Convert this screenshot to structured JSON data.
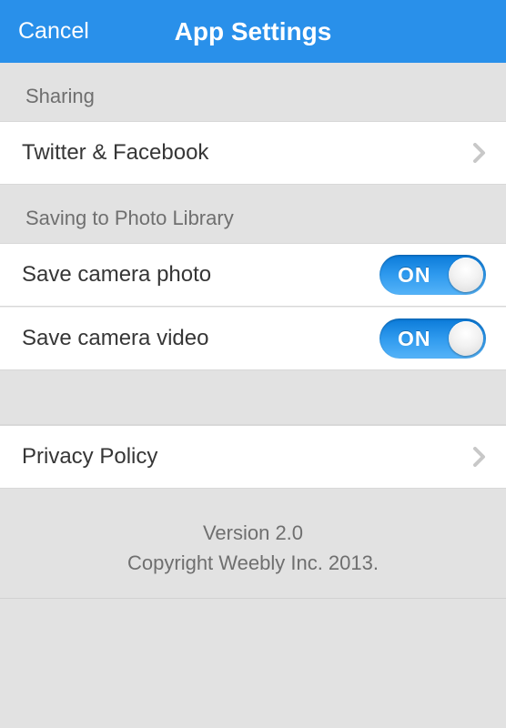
{
  "nav": {
    "cancel": "Cancel",
    "title": "App Settings"
  },
  "sections": {
    "sharing_header": "Sharing",
    "twitter_facebook": "Twitter & Facebook",
    "saving_header": "Saving to Photo Library",
    "save_photo": "Save camera photo",
    "save_video": "Save camera video",
    "privacy_policy": "Privacy Policy"
  },
  "toggles": {
    "on_label": "ON",
    "save_photo_state": "ON",
    "save_video_state": "ON"
  },
  "footer": {
    "version": "Version 2.0",
    "copyright": "Copyright Weebly Inc. 2013."
  }
}
